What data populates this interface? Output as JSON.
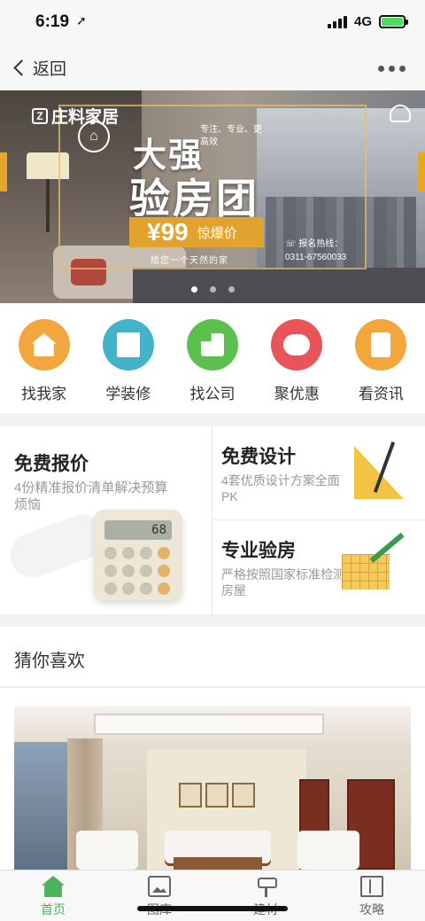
{
  "status": {
    "time": "6:19",
    "location_arrow": "➚",
    "network": "4G",
    "battery_level": 1.0
  },
  "nav": {
    "back_label": "返回"
  },
  "banner": {
    "brand": "庄料家居",
    "brand_mark": "Z",
    "tagline": "专注、专业、更高效",
    "headline1": "大强",
    "headline2": "验房团",
    "price": "¥99",
    "price_note": "惊爆价",
    "slogan": "给您一个天然的家",
    "hotline_label": "报名热线：",
    "hotline_number": "0311-67560033",
    "slides_total": 3,
    "slide_active": 1
  },
  "quick_menu": [
    {
      "label": "找我家",
      "color": "#f2a63c",
      "icon": "house-icon"
    },
    {
      "label": "学装修",
      "color": "#42b3c8",
      "icon": "book-icon"
    },
    {
      "label": "找公司",
      "color": "#5cc04f",
      "icon": "building-icon"
    },
    {
      "label": "聚优惠",
      "color": "#e9535a",
      "icon": "coupon-icon"
    },
    {
      "label": "看资讯",
      "color": "#f2a63c",
      "icon": "news-icon"
    }
  ],
  "features": {
    "quote": {
      "title": "免费报价",
      "desc": "4份精准报价清单解决预算烦恼",
      "calc_display": "68"
    },
    "design": {
      "title": "免费设计",
      "desc": "4套优质设计方案全面PK"
    },
    "inspect": {
      "title": "专业验房",
      "desc": "严格按照国家标准检测房屋"
    }
  },
  "recommend": {
    "title": "猜你喜欢"
  },
  "tabs": [
    {
      "label": "首页",
      "icon": "home-icon",
      "active": true
    },
    {
      "label": "图库",
      "icon": "gallery-icon",
      "active": false
    },
    {
      "label": "建材",
      "icon": "paint-roller-icon",
      "active": false
    },
    {
      "label": "攻略",
      "icon": "guide-book-icon",
      "active": false
    }
  ],
  "colors": {
    "accent_green": "#4cb25c",
    "banner_gold": "#e2a22e"
  }
}
